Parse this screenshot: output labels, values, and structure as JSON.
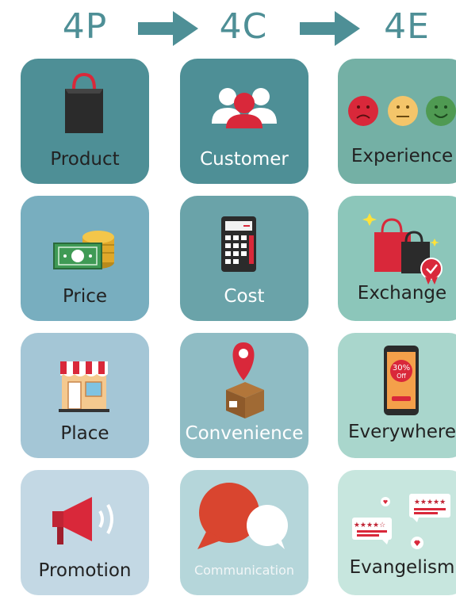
{
  "headers": {
    "h1": "4P",
    "h2": "4C",
    "h3": "4E"
  },
  "colors": {
    "header": "#4e8f96",
    "arrow": "#4e8f96",
    "col1": [
      "#4e8f96",
      "#78aebf",
      "#a4c6d6",
      "#c3d8e4"
    ],
    "col2": [
      "#4e8f96",
      "#6aa3a9",
      "#8fbcc4",
      "#b5d6da"
    ],
    "col3": [
      "#74b0a5",
      "#8cc6ba",
      "#a9d6cc",
      "#c7e6de"
    ]
  },
  "cards": {
    "product": {
      "label": "Product",
      "icon": "shopping-bag-icon"
    },
    "customer": {
      "label": "Customer",
      "icon": "people-icon"
    },
    "experience": {
      "label": "Experience",
      "icon": "emoji-faces-icon"
    },
    "price": {
      "label": "Price",
      "icon": "money-coins-icon"
    },
    "cost": {
      "label": "Cost",
      "icon": "calculator-icon"
    },
    "exchange": {
      "label": "Exchange",
      "icon": "shopping-bags-badge-icon"
    },
    "place": {
      "label": "Place",
      "icon": "storefront-icon"
    },
    "convenience": {
      "label": "Convenience",
      "icon": "location-box-icon"
    },
    "everywhere": {
      "label": "Everywhere",
      "icon": "phone-discount-icon"
    },
    "promotion": {
      "label": "Promotion",
      "icon": "megaphone-icon"
    },
    "communication": {
      "label": "Communication",
      "icon": "speech-bubbles-icon"
    },
    "evangelism": {
      "label": "Evangelism",
      "icon": "reviews-icon"
    }
  },
  "icon_text": {
    "discount_line1": "30%",
    "discount_line2": "Off"
  }
}
